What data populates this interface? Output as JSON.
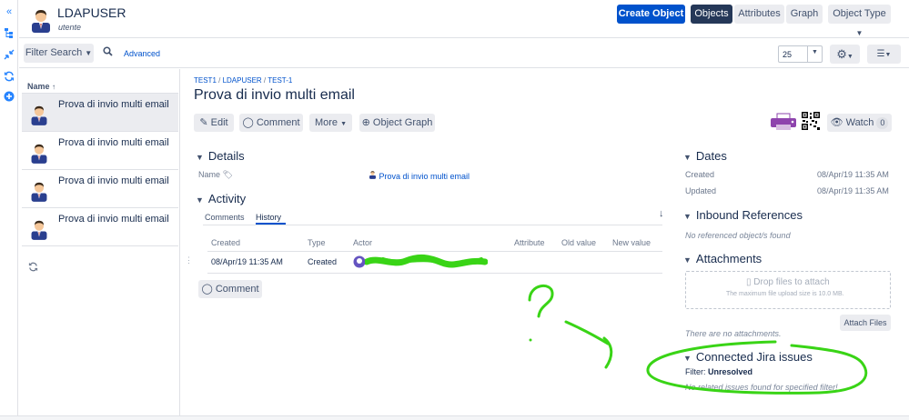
{
  "header": {
    "title": "LDAPUSER",
    "subtitle": "utente",
    "create_label": "Create Object",
    "views": [
      "Objects",
      "Attributes",
      "Graph"
    ],
    "object_type_label": "Object Type"
  },
  "filterbar": {
    "filter_label": "Filter Search",
    "advanced_label": "Advanced",
    "page_size": "25"
  },
  "list": {
    "header": "Name",
    "items": [
      {
        "label": "Prova di invio multi email"
      },
      {
        "label": "Prova di invio multi email"
      },
      {
        "label": "Prova di invio multi email"
      },
      {
        "label": "Prova di invio multi email"
      }
    ]
  },
  "detail": {
    "breadcrumb": [
      "TEST1",
      "LDAPUSER",
      "TEST-1"
    ],
    "breadcrumb_sep": " / ",
    "title": "Prova di invio multi email",
    "actions": {
      "edit": "Edit",
      "comment": "Comment",
      "more": "More",
      "graph": "Object Graph"
    },
    "watch_label": "Watch",
    "watch_count": "0",
    "details_heading": "Details",
    "name_label": "Name",
    "name_value": "Prova di invio multi email",
    "activity_heading": "Activity",
    "tabs": [
      "Comments",
      "History"
    ],
    "active_tab": "History",
    "table_headers": [
      "Created",
      "Type",
      "Actor",
      "Attribute",
      "Old value",
      "New value"
    ],
    "row": {
      "created": "08/Apr/19 11:35 AM",
      "type": "Created"
    },
    "comment_button": "Comment"
  },
  "side": {
    "dates_heading": "Dates",
    "created_label": "Created",
    "created_value": "08/Apr/19 11:35 AM",
    "updated_label": "Updated",
    "updated_value": "08/Apr/19 11:35 AM",
    "inbound_heading": "Inbound References",
    "inbound_empty": "No referenced object/s found",
    "attachments_heading": "Attachments",
    "drop_label": "Drop files to attach",
    "max_size": "The maximum file upload size is 10.0 MB.",
    "no_attachments": "There are no attachments.",
    "attach_button": "Attach Files",
    "jira_heading": "Connected Jira issues",
    "filter_label": "Filter:",
    "filter_value": "Unresolved",
    "jira_empty": "No related issues found for specified filter!"
  },
  "colors": {
    "primary": "#0052cc",
    "annotation": "#39d416",
    "dark": "#253858"
  }
}
